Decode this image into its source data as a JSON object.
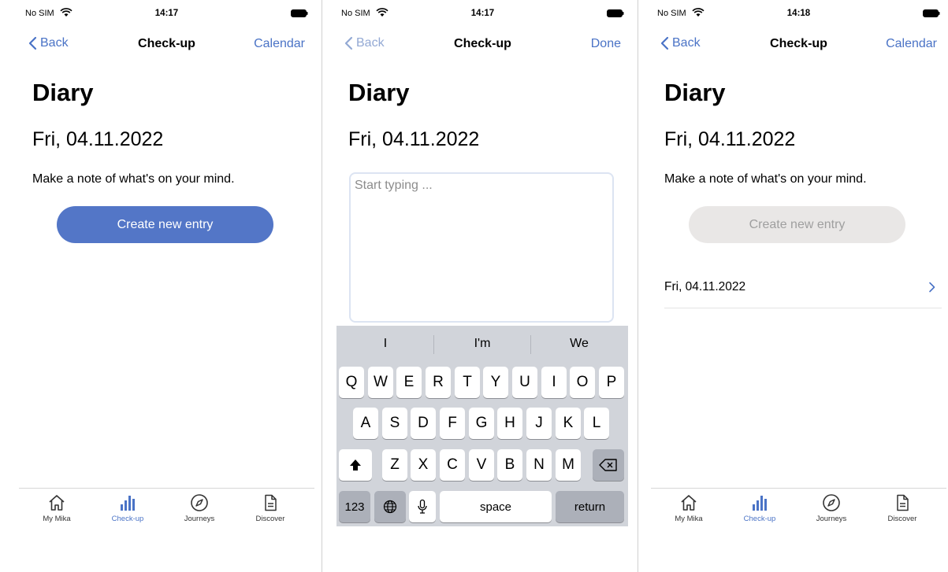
{
  "status": {
    "carrier": "No SIM",
    "time1": "14:17",
    "time2": "14:17",
    "time3": "14:18"
  },
  "nav": {
    "back": "Back",
    "title": "Check-up",
    "calendar": "Calendar",
    "done": "Done"
  },
  "diary": {
    "heading": "Diary",
    "date": "Fri, 04.11.2022",
    "prompt": "Make a note of what's on your mind.",
    "create_label": "Create new entry",
    "textarea_placeholder": "Start typing ...",
    "entries": [
      "Fri, 04.11.2022"
    ]
  },
  "keyboard": {
    "suggestions": [
      "I",
      "I'm",
      "We"
    ],
    "row1": [
      "Q",
      "W",
      "E",
      "R",
      "T",
      "Y",
      "U",
      "I",
      "O",
      "P"
    ],
    "row2": [
      "A",
      "S",
      "D",
      "F",
      "G",
      "H",
      "J",
      "K",
      "L"
    ],
    "row3": [
      "Z",
      "X",
      "C",
      "V",
      "B",
      "N",
      "M"
    ],
    "num_label": "123",
    "space_label": "space",
    "return_label": "return",
    "icons": [
      "shift-icon",
      "backspace-icon",
      "globe-icon",
      "microphone-icon"
    ]
  },
  "tabs": [
    {
      "label": "My Mika",
      "icon": "home-icon"
    },
    {
      "label": "Check-up",
      "icon": "bar-chart-icon",
      "active": true
    },
    {
      "label": "Journeys",
      "icon": "compass-icon"
    },
    {
      "label": "Discover",
      "icon": "document-icon"
    }
  ],
  "colors": {
    "accent": "#4a73c6",
    "button": "#5376c7",
    "disabled_button": "#e9e7e6",
    "keyboard_bg": "#d1d4da"
  }
}
